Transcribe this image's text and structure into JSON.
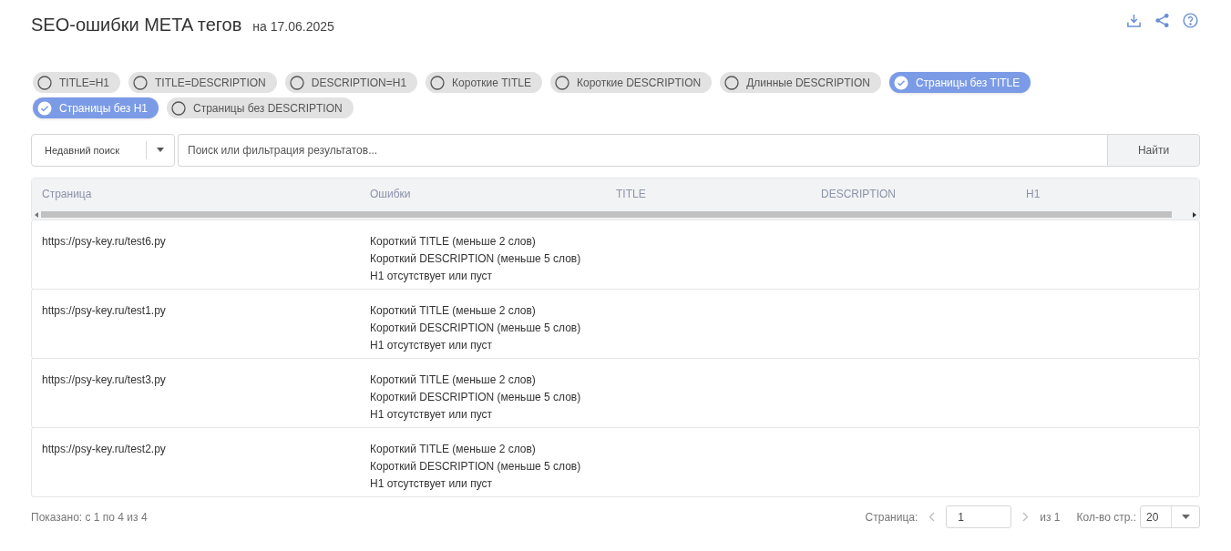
{
  "header": {
    "title": "SEO-ошибки META тегов",
    "date": "на 17.06.2025"
  },
  "filters": [
    {
      "label": "TITLE=H1",
      "selected": false
    },
    {
      "label": "TITLE=DESCRIPTION",
      "selected": false
    },
    {
      "label": "DESCRIPTION=H1",
      "selected": false
    },
    {
      "label": "Короткие TITLE",
      "selected": false
    },
    {
      "label": "Короткие DESCRIPTION",
      "selected": false
    },
    {
      "label": "Длинные DESCRIPTION",
      "selected": false
    },
    {
      "label": "Страницы без TITLE",
      "selected": true
    },
    {
      "label": "Страницы без H1",
      "selected": true
    },
    {
      "label": "Страницы без DESCRIPTION",
      "selected": false
    }
  ],
  "search": {
    "recent": "Недавний поиск",
    "placeholder": "Поиск или фильтрация результатов...",
    "button": "Найти"
  },
  "table": {
    "columns": [
      "Страница",
      "Ошибки",
      "TITLE",
      "DESCRIPTION",
      "H1"
    ],
    "rows": [
      {
        "page": "https://psy-key.ru/test6.py",
        "errors": [
          "Короткий TITLE (меньше 2 слов)",
          "Короткий DESCRIPTION (меньше 5 слов)",
          "H1 отсутствует или пуст"
        ]
      },
      {
        "page": "https://psy-key.ru/test1.py",
        "errors": [
          "Короткий TITLE (меньше 2 слов)",
          "Короткий DESCRIPTION (меньше 5 слов)",
          "H1 отсутствует или пуст"
        ]
      },
      {
        "page": "https://psy-key.ru/test3.py",
        "errors": [
          "Короткий TITLE (меньше 2 слов)",
          "Короткий DESCRIPTION (меньше 5 слов)",
          "H1 отсутствует или пуст"
        ]
      },
      {
        "page": "https://psy-key.ru/test2.py",
        "errors": [
          "Короткий TITLE (меньше 2 слов)",
          "Короткий DESCRIPTION (меньше 5 слов)",
          "H1 отсутствует или пуст"
        ]
      }
    ]
  },
  "footer": {
    "shown": "Показано: с 1 по 4 из 4",
    "page_label": "Страница:",
    "page_value": "1",
    "of": "из 1",
    "per_page_label": "Кол-во стр.:",
    "per_page": "20"
  }
}
